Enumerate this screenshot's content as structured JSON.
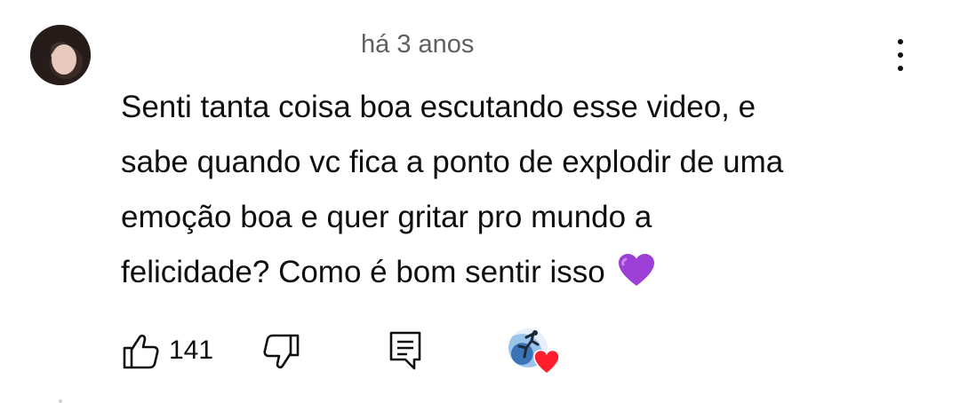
{
  "comment": {
    "timestamp": "há 3 anos",
    "text_lines": [
      "Senti tanta coisa boa escutando esse video, e",
      "sabe quando vc fica a ponto de explodir de uma",
      "emoção boa e quer gritar pro mundo a",
      "felicidade? Como é bom sentir isso"
    ],
    "emoji": "purple-heart-emoji",
    "like_count": "141"
  },
  "icons": {
    "avatar": "user-avatar",
    "menu": "more-vertical-icon",
    "like": "thumbs-up-icon",
    "dislike": "thumbs-down-icon",
    "reply": "comment-icon",
    "creator_heart": "creator-heart-badge"
  },
  "colors": {
    "text": "#0f0f0f",
    "secondary_text": "#606060",
    "purple_heart": "#9b3fd6",
    "red_heart": "#ff1e2d"
  }
}
